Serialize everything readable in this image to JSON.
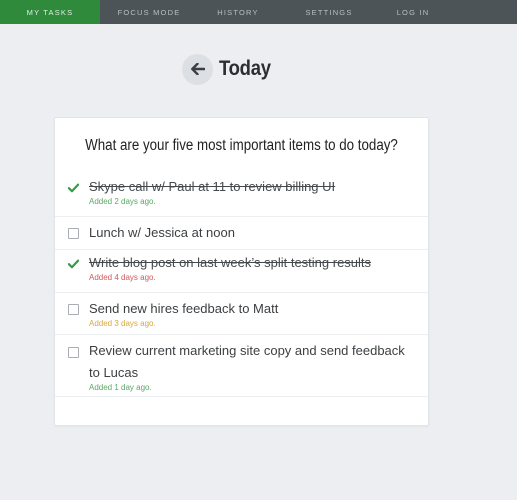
{
  "nav": {
    "items": [
      {
        "label": "MY TASKS",
        "active": true
      },
      {
        "label": "FOCUS MODE",
        "active": false
      },
      {
        "label": "HISTORY",
        "active": false
      },
      {
        "label": "SETTINGS",
        "active": false
      },
      {
        "label": "LOG IN",
        "active": false
      }
    ]
  },
  "page": {
    "back_icon": "arrow-left-icon",
    "title": "Today"
  },
  "card": {
    "question": "What are your five most important items to do today?",
    "tasks": [
      {
        "text": "Skype call w/ Paul at 11 to review billing UI",
        "completed": true,
        "added": "Added 2 days ago.",
        "added_color": "#5aa866"
      },
      {
        "text": "Lunch w/ Jessica at noon",
        "completed": false,
        "added": "",
        "added_color": ""
      },
      {
        "text": "Write blog post on last week’s split testing results",
        "completed": true,
        "added": "Added 4 days ago.",
        "added_color": "#d4595b"
      },
      {
        "text": "Send new hires feedback to Matt",
        "completed": false,
        "added": "Added 3 days ago.",
        "added_color": "#d6aa3c"
      },
      {
        "text": "Review current marketing site copy and send feedback to Lucas",
        "completed": false,
        "added": "Added 1 day ago.",
        "added_color": "#5aa866"
      }
    ]
  },
  "colors": {
    "nav_bg": "#4d5458",
    "nav_active": "#2f8a3c",
    "check_green": "#3a9a4a",
    "page_bg": "#eceef1"
  }
}
